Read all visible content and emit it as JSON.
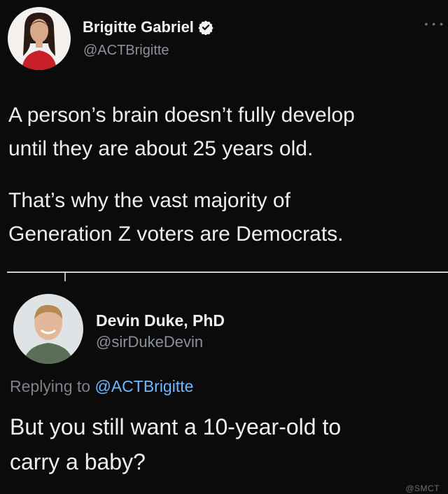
{
  "original_tweet": {
    "author": {
      "name": "Brigitte Gabriel",
      "handle": "@ACTBrigitte",
      "verified_icon": "verified-badge-icon"
    },
    "more_icon": "more-options-icon",
    "paragraphs": [
      "A person’s brain doesn’t fully develop\nuntil they are about 25 years old.",
      "That’s why the vast majority of\nGeneration Z voters are Democrats."
    ]
  },
  "reply_tweet": {
    "author": {
      "name": "Devin Duke, PhD",
      "handle": "@sirDukeDevin"
    },
    "replying_to": {
      "prefix": "Replying to ",
      "mention": "@ACTBrigitte"
    },
    "text": "But you still want a 10-year-old to\ncarry a baby?"
  },
  "watermark": "@SMCT",
  "colors": {
    "background": "#0b0b0c",
    "text": "#eceff1",
    "secondary_text": "#8b9198",
    "link": "#6fb7ff",
    "divider": "#d0d0d0"
  }
}
